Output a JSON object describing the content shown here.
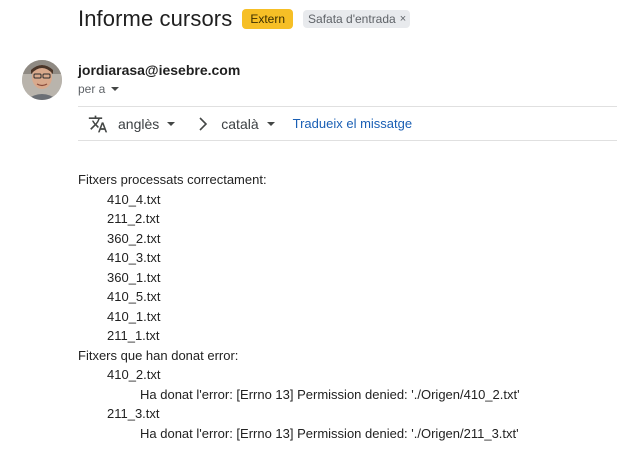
{
  "email": {
    "subject": "Informe cursors",
    "labels": {
      "extern": "Extern",
      "inbox": "Safata d'entrada",
      "inbox_close": "×"
    },
    "sender": "jordiarasa@iesebre.com",
    "recipients": "per a"
  },
  "translate": {
    "icon": "translate-icon",
    "from_lang": "anglès",
    "to_lang": "català",
    "translate_link": "Tradueix el missatge"
  },
  "body": {
    "success_header": "Fitxers processats correctament:",
    "success_files": [
      "410_4.txt",
      "211_2.txt",
      "360_2.txt",
      "410_3.txt",
      "360_1.txt",
      "410_5.txt",
      "410_1.txt",
      "211_1.txt"
    ],
    "error_header": "Fitxers que han donat error:",
    "errors": [
      {
        "file": "410_2.txt",
        "message": "Ha donat l'error: [Errno 13] Permission denied: './Origen/410_2.txt'"
      },
      {
        "file": "211_3.txt",
        "message": "Ha donat l'error: [Errno 13] Permission denied: './Origen/211_3.txt'"
      }
    ]
  },
  "colors": {
    "extern_badge": "#f6bf26",
    "link": "#1a5fb4"
  }
}
